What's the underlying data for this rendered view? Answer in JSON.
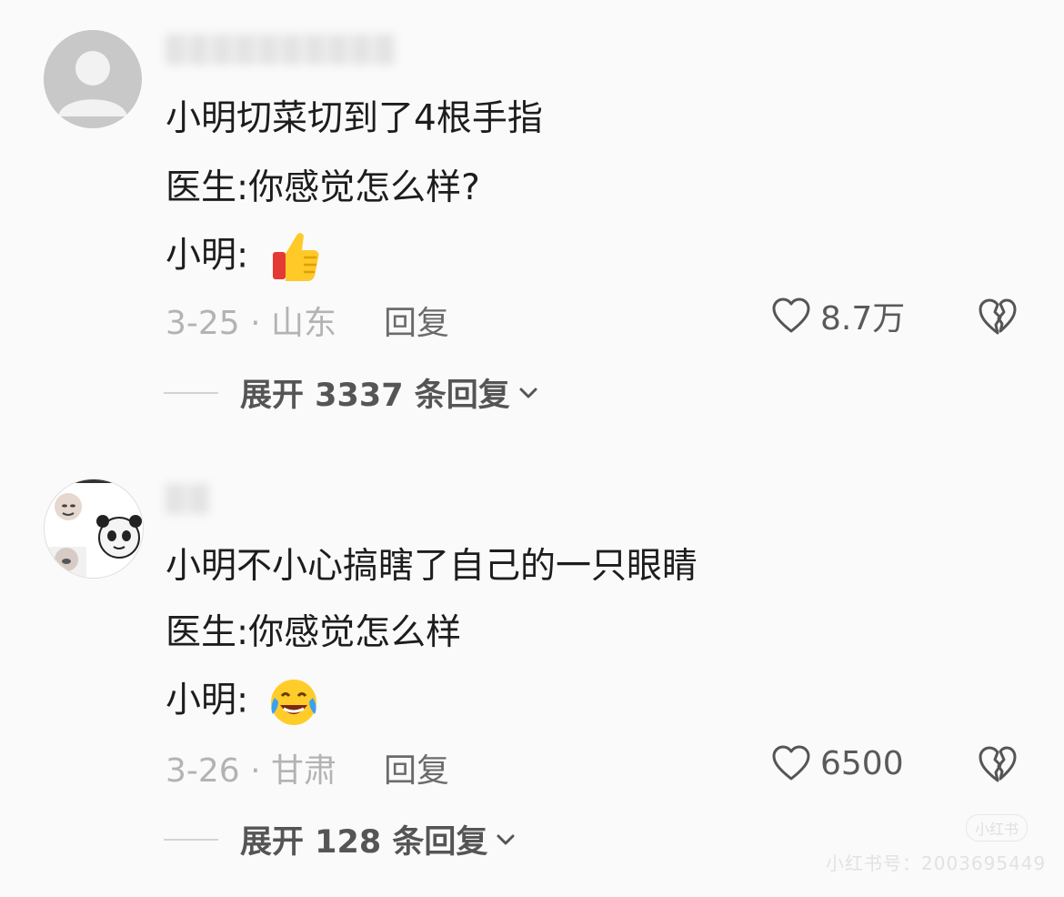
{
  "comments": [
    {
      "lines": [
        "小明切菜切到了4根手指",
        "医生:你感觉怎么样?",
        "小明:"
      ],
      "emoji": "thumbs-up-icon",
      "date_location": "3-25 · 山东",
      "reply_label": "回复",
      "like_count": "8.7万",
      "expand_label": "展开 3337 条回复"
    },
    {
      "lines": [
        "小明不小心搞瞎了自己的一只眼睛",
        "医生:你感觉怎么样",
        "小明:"
      ],
      "emoji": "laughing-crying-face-icon",
      "date_location": "3-26 · 甘肃",
      "reply_label": "回复",
      "like_count": "6500",
      "expand_label": "展开 128 条回复"
    }
  ],
  "watermark": {
    "badge": "小红书",
    "text": "小红书号：2003695449"
  }
}
